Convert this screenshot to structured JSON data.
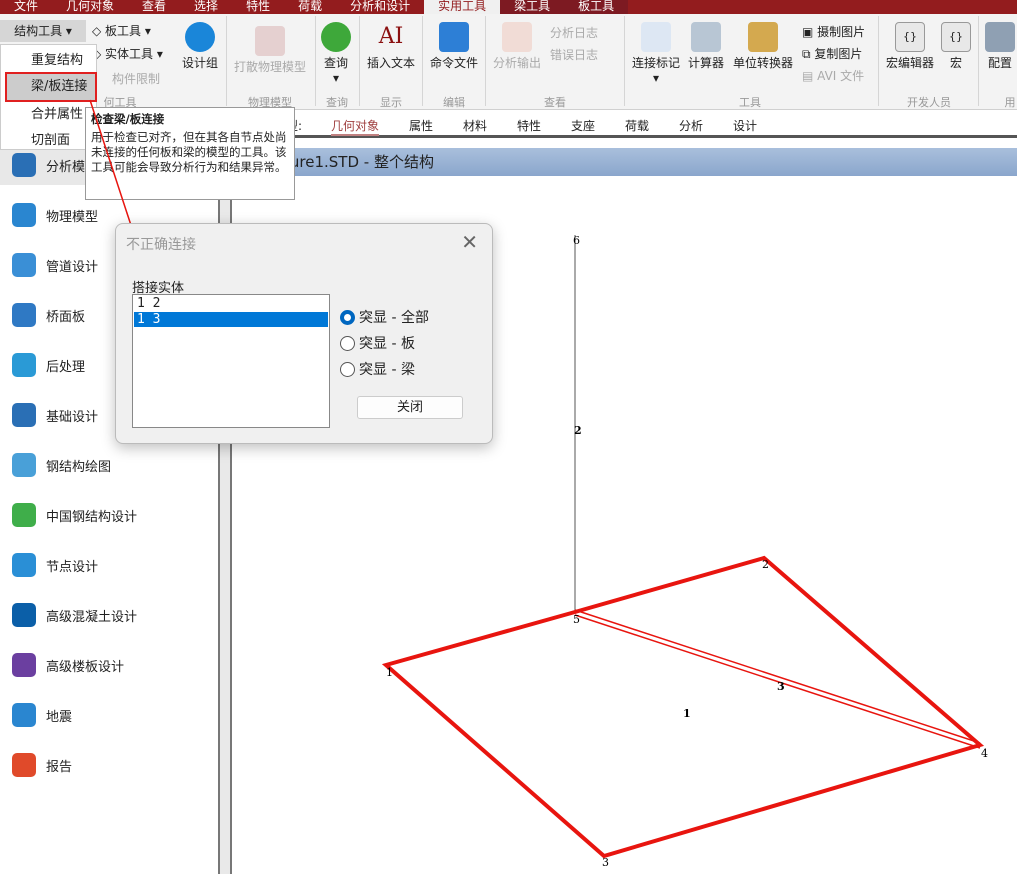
{
  "menubar": {
    "tabs": [
      "文件",
      "几何对象",
      "查看",
      "选择",
      "特性",
      "荷载",
      "分析和设计",
      "实用工具",
      "梁工具",
      "板工具"
    ],
    "active": "实用工具"
  },
  "ribbon": {
    "struct_tools": "结构工具",
    "plate_tools": "板工具",
    "solid_tools": "实体工具",
    "member_limits": "构件限制",
    "design_group": "设计组",
    "break_physical": "打散物理模型",
    "query": "查询",
    "insert_text": "插入文本",
    "command_file": "命令文件",
    "analysis_output": "分析输出",
    "analysis_log": "分析日志",
    "error_log": "错误日志",
    "connection_marker": "连接标记",
    "calculator": "计算器",
    "unit_converter": "单位转换器",
    "capture_image": "摄制图片",
    "copy_image": "复制图片",
    "avi_file": "AVI 文件",
    "macro_editor": "宏编辑器",
    "macro": "宏",
    "config": "配置",
    "groups": {
      "geometry": "何工具",
      "physical": "物理模型",
      "query": "查询",
      "display": "显示",
      "edit": "编辑",
      "view": "查看",
      "tools": "工具",
      "developer": "开发人员",
      "other": "用"
    }
  },
  "subtabs": {
    "prefix": "型:",
    "items": [
      "几何对象",
      "属性",
      "材料",
      "特性",
      "支座",
      "荷载",
      "分析",
      "设计"
    ]
  },
  "dropdown": {
    "items": [
      "重复结构",
      "梁/板连接",
      "合并属性",
      "切剖面"
    ]
  },
  "tooltip": {
    "title": "检查梁/板连接",
    "body": "用于检查已对齐，但在其各自节点处尚未连接的任何板和梁的模型的工具。该工具可能会导致分析行为和结果异常。"
  },
  "sidebar": {
    "items": [
      "分析模型",
      "物理模型",
      "管道设计",
      "桥面板",
      "后处理",
      "基础设计",
      "钢结构绘图",
      "中国钢结构设计",
      "节点设计",
      "高级混凝土设计",
      "高级楼板设计",
      "地震",
      "报告"
    ]
  },
  "viewport": {
    "title": "ture1.STD - 整个结构",
    "node_labels": [
      "1",
      "2",
      "3",
      "4",
      "5",
      "6"
    ],
    "member_labels": [
      "1",
      "2",
      "3"
    ]
  },
  "dialog": {
    "title": "不正确连接",
    "list_label": "搭接实体",
    "list": [
      "1 2",
      "1 3"
    ],
    "selected": 1,
    "radios": [
      "突显 - 全部",
      "突显 - 板",
      "突显 - 梁"
    ],
    "radio_selected": 0,
    "close": "关闭"
  }
}
